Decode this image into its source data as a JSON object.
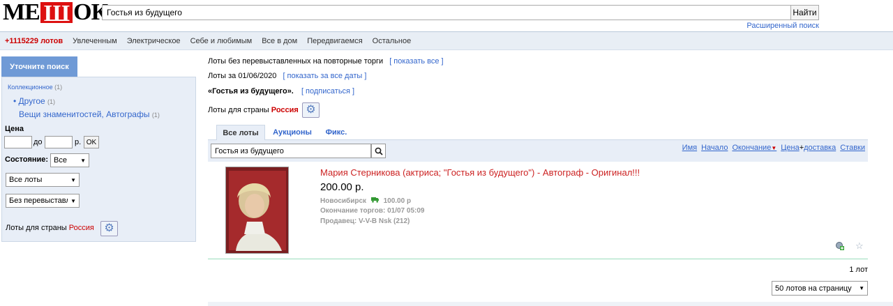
{
  "header": {
    "logo_pre": "МЕ",
    "logo_box": "Ш",
    "logo_post": "ОК",
    "search_value": "Гостья из будущего",
    "search_button": "Найти",
    "advanced_search": "Расширенный поиск"
  },
  "nav": {
    "lots_count": "+1115229 лотов",
    "items": [
      "Увлеченным",
      "Электрическое",
      "Себе и любимым",
      "Все в дом",
      "Передвигаемся",
      "Остальное"
    ]
  },
  "sidebar": {
    "tab_label": "Уточните поиск",
    "category": "Коллекционное",
    "category_count": "(1)",
    "subcategory": "• Другое",
    "subcategory_count": "(1)",
    "subsubcategory": "Вещи знаменитостей, Автографы",
    "subsubcategory_count": "(1)",
    "price_label": "Цена",
    "price_to": "до",
    "price_currency": "р.",
    "ok_label": "OK",
    "condition_label": "Состояние:",
    "condition_value": "Все",
    "lots_type_value": "Все лоты",
    "relist_value": "Без перевыставле",
    "country_label": "Лоты для страны",
    "country_value": "Россия"
  },
  "main": {
    "line1_text": "Лоты без перевыставленных на повторные торги",
    "line1_link": "[ показать все ]",
    "line2_text": "Лоты за 01/06/2020",
    "line2_link": "[ показать за все даты ]",
    "line3_text": "«Гостья из будущего».",
    "line3_link": "[ подписаться ]",
    "country_label": "Лоты для страны",
    "country_value": "Россия",
    "tabs": [
      "Все лоты",
      "Аукционы",
      "Фикс."
    ],
    "filter_value": "Гостья из будущего",
    "sorts": {
      "name": "Имя",
      "start": "Начало",
      "end": "Окончание",
      "price": "Цена",
      "plus": "+",
      "delivery": "доставка",
      "bids": "Ставки"
    }
  },
  "lot": {
    "title": "Мария Стерникова (актриса; \"Гостья из будущего\") - Автограф - Оригинал!!!",
    "price": "200.00 р.",
    "city": "Новосибирск",
    "delivery_price": "100.00 р",
    "end_label": "Окончание торгов: 01/07 05:09",
    "seller": "Продавец: V-V-B Nsk (212)"
  },
  "footer": {
    "total": "1 лот",
    "per_page": "50 лотов на страницу"
  },
  "colors": {
    "accent_blue": "#3366cc",
    "brand_red": "#dd1111",
    "sidebar_tab": "#6f9ad6"
  }
}
